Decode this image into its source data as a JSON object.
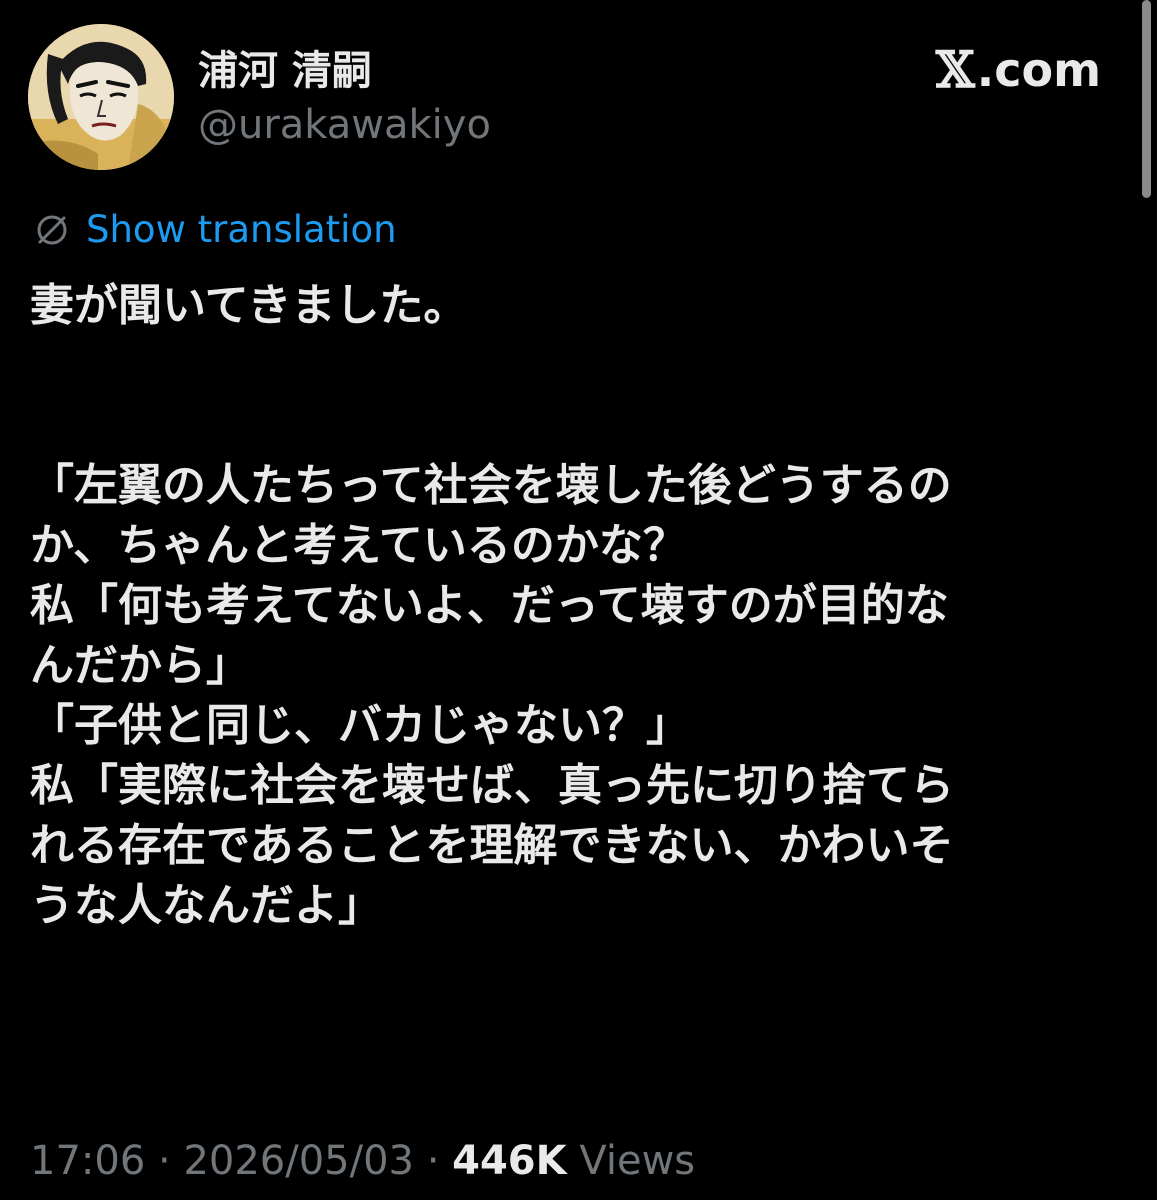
{
  "header": {
    "display_name": "浦河 清嗣",
    "handle": "@urakawakiyo",
    "brand_x": "𝕏",
    "brand_text": ".com",
    "avatar_icon": "ukiyoe-portrait-avatar"
  },
  "translation": {
    "icon": "globe-slash-icon",
    "label": "Show translation"
  },
  "tweet": {
    "lines": [
      "妻が聞いてきました。",
      "",
      "",
      "「左翼の人たちって社会を壊した後どうするの",
      "か、ちゃんと考えているのかな？",
      "私「何も考えてないよ、だって壊すのが目的な",
      "んだから」",
      "「子供と同じ、バカじゃない？」",
      "私「実際に社会を壊せば、真っ先に切り捨てら",
      "れる存在であることを理解できない、かわいそ",
      "うな人なんだよ」"
    ]
  },
  "meta": {
    "time": "17:06",
    "separator": " · ",
    "date": "2026/05/03",
    "views_count": "446K",
    "views_label": " Views"
  },
  "colors": {
    "background": "#000000",
    "primary_text": "#e7e9ea",
    "secondary_text": "#71767b",
    "link": "#1d9bf0"
  }
}
